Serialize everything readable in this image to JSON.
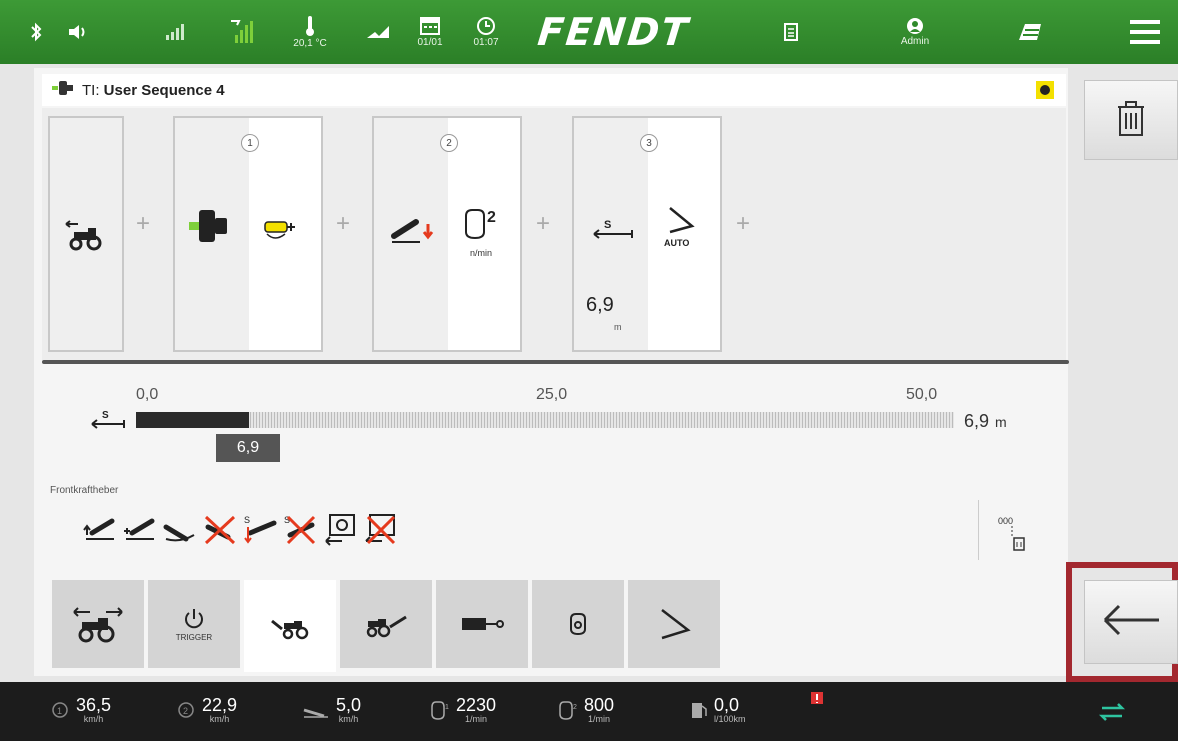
{
  "topbar": {
    "temperature": "20,1 °C",
    "date": "01/01",
    "time": "01:07",
    "brand": "FENDT",
    "user": "Admin",
    "icons": [
      "bluetooth-icon",
      "speaker-icon",
      "signal-icon",
      "gps-signal-icon",
      "thermometer-icon",
      "loader-icon",
      "calendar-icon",
      "clock-icon",
      "document-icon",
      "user-icon",
      "field-icon",
      "menu-icon"
    ]
  },
  "title": {
    "prefix": "TI: ",
    "name": "User Sequence 4"
  },
  "sequence": {
    "steps": [
      {
        "number": "1"
      },
      {
        "number": "2",
        "unit": "n/min"
      },
      {
        "number": "3",
        "value": "6,9",
        "unit": "m",
        "mode": "AUTO"
      }
    ],
    "plus": "+"
  },
  "slider": {
    "ticks": [
      "0,0",
      "25,0",
      "50,0"
    ],
    "current": "6,9",
    "display_value": "6,9",
    "display_unit": "m",
    "fraction": 0.138
  },
  "section": {
    "label": "Frontkraftheber"
  },
  "tabs": [
    {
      "id": "tractor-turn",
      "caption": ""
    },
    {
      "id": "trigger",
      "caption": "TRIGGER"
    },
    {
      "id": "rear-hitch",
      "caption": ""
    },
    {
      "id": "front-hitch",
      "caption": ""
    },
    {
      "id": "hydraulic",
      "caption": ""
    },
    {
      "id": "engine",
      "caption": ""
    },
    {
      "id": "steering",
      "caption": ""
    }
  ],
  "statusbar": {
    "speed1": {
      "value": "36,5",
      "unit": "km/h"
    },
    "speed2": {
      "value": "22,9",
      "unit": "km/h"
    },
    "slip": {
      "value": "5,0",
      "unit": "km/h"
    },
    "engine_rpm": {
      "value": "2230",
      "unit": "1/min"
    },
    "pto_rpm": {
      "value": "800",
      "unit": "1/min"
    },
    "fuel": {
      "value": "0,0",
      "unit": "l/100km"
    }
  },
  "colors": {
    "brand_green": "#2f8a2b",
    "highlight_red": "#a3282f",
    "warning_yellow": "#f3e000"
  }
}
